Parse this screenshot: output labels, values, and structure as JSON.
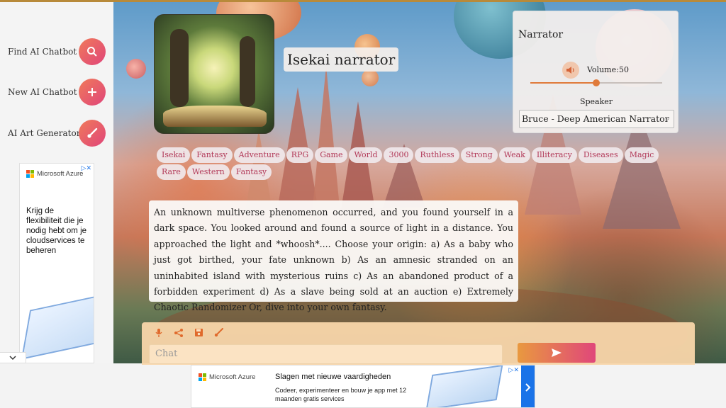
{
  "sidebar": {
    "items": [
      {
        "label": "Find AI Chatbot",
        "icon": "search-icon"
      },
      {
        "label": "New AI Chatbot",
        "icon": "plus-icon"
      },
      {
        "label": "AI Art Generator",
        "icon": "brush-icon"
      }
    ],
    "collapse_icon": "chevron-down-icon"
  },
  "left_ad": {
    "brand": "Microsoft Azure",
    "text": "Krijg de flexibiliteit die je nodig hebt om je cloudservices te beheren"
  },
  "chatbot": {
    "title": "Isekai narrator",
    "tags": [
      "Isekai",
      "Fantasy",
      "Adventure",
      "RPG",
      "Game",
      "World",
      "3000",
      "Ruthless",
      "Strong",
      "Weak",
      "Illiteracy",
      "Diseases",
      "Magic",
      "Rare",
      "Western",
      "Fantasy"
    ],
    "story": "An unknown multiverse phenomenon occurred, and you found yourself in a dark space. You looked around and found a source of light in a distance. You approached the light and *whoosh*.... Choose your origin: a) As a baby who just got birthed, your fate unknown b) As an amnesic stranded on an uninhabited island with mysterious ruins c) As an abandoned product of a forbidden experiment d) As a slave being sold at an auction e) Extremely Chaotic Randomizer Or, dive into your own fantasy."
  },
  "narrator": {
    "title": "Narrator",
    "volume_label": "Volume:",
    "volume_value": "50",
    "volume_fraction": 0.5,
    "speaker_label": "Speaker",
    "speaker_selected": "Bruce - Deep American Narrator"
  },
  "chat": {
    "tools": [
      "microphone-icon",
      "share-icon",
      "save-icon",
      "brush-icon"
    ],
    "placeholder": "Chat",
    "send_icon": "send-icon"
  },
  "bottom_ad": {
    "brand": "Microsoft Azure",
    "headline": "Slagen met nieuwe vaardigheden",
    "body": "Codeer, experimenteer en bouw je app met 12 maanden gratis services"
  },
  "colors": {
    "accent_gradient_start": "#f07a5a",
    "accent_gradient_end": "#e0457a",
    "tag_text": "#b23a59",
    "chat_bar": "#f8d6aa"
  }
}
